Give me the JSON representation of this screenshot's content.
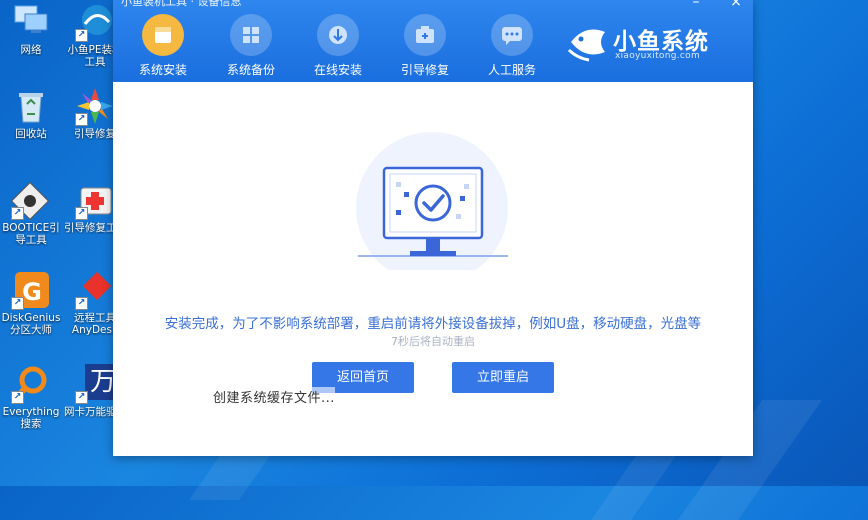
{
  "desktop": {
    "icons": [
      {
        "label": "网络",
        "icon": "network-icon"
      },
      {
        "label": "小鱼PE装机工具",
        "icon": "pe-installer-icon"
      },
      {
        "label": "回收站",
        "icon": "recycle-bin-icon"
      },
      {
        "label": "引导修复",
        "icon": "boot-repair-icon"
      },
      {
        "label": "BOOTICE引导工具",
        "icon": "bootice-icon"
      },
      {
        "label": "引导修复工具",
        "icon": "boot-repair-tool-icon"
      },
      {
        "label": "DiskGenius分区大师",
        "icon": "diskgenius-icon"
      },
      {
        "label": "远程工具AnyDesk",
        "icon": "anydesk-icon"
      },
      {
        "label": "Everything搜索",
        "icon": "everything-search-icon"
      },
      {
        "label": "网卡万能驱动",
        "icon": "nic-driver-icon"
      }
    ],
    "icon_glyphs": {
      "nic": "万"
    }
  },
  "window": {
    "title": "小鱼装机工具 · 设备信息",
    "controls": {
      "minimize": "–",
      "close": "×"
    }
  },
  "nav": [
    {
      "label": "系统安装",
      "icon": "system-install-icon",
      "active": true
    },
    {
      "label": "系统备份",
      "icon": "system-backup-icon",
      "active": false
    },
    {
      "label": "在线安装",
      "icon": "online-install-icon",
      "active": false
    },
    {
      "label": "引导修复",
      "icon": "boot-repair-icon",
      "active": false
    },
    {
      "label": "人工服务",
      "icon": "chat-service-icon",
      "active": false
    }
  ],
  "brand": {
    "name": "小鱼系统",
    "url": "xiaoyuxitong.com"
  },
  "main": {
    "message": "安装完成，为了不影响系统部署，重启前请将外接设备拔掉，例如U盘，移动硬盘，光盘等",
    "countdown": "7秒后将自动重启",
    "buttons": {
      "home": "返回首页",
      "restart": "立即重启"
    },
    "status": "创建系统缓存文件..."
  },
  "colors": {
    "accent": "#3577e6",
    "header": "#2f86ee",
    "active_nav": "#f5b941"
  }
}
